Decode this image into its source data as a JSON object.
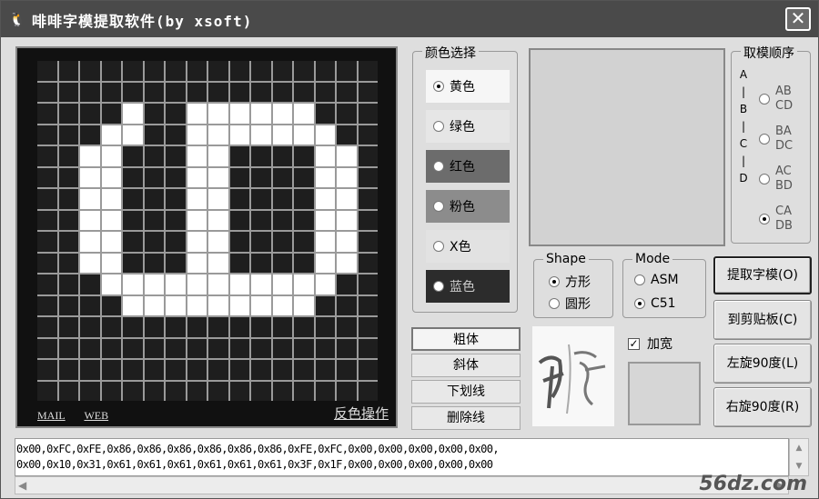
{
  "window": {
    "title": "啡啡字模提取软件(by xsoft)",
    "icon": "penguin-icon",
    "close_label": "✕"
  },
  "grid": {
    "rows": 16,
    "cols": 16,
    "on_cells": [
      [
        2,
        5
      ],
      [
        3,
        5
      ],
      [
        2,
        12
      ],
      [
        2,
        13
      ],
      [
        2,
        14
      ],
      [
        2,
        15
      ],
      [
        2,
        16
      ],
      [
        2,
        17
      ],
      [
        2,
        18
      ],
      [
        2,
        19
      ],
      [
        2,
        20
      ],
      [
        2,
        21
      ],
      [
        2,
        22
      ],
      [
        2,
        23
      ],
      [
        3,
        8
      ],
      [
        3,
        9
      ],
      [
        3,
        10
      ],
      [
        3,
        11
      ],
      [
        3,
        12
      ],
      [
        3,
        13
      ],
      [
        3,
        14
      ],
      [
        3,
        15
      ]
    ],
    "pattern": [
      "0000000000000000",
      "0000000000000000",
      "0000100111111000",
      "0001100111111100",
      "0011000110000110",
      "0011000110000110",
      "0011000110000110",
      "0011000110000110",
      "0011000110000110",
      "0011000110000110",
      "0001111111111100",
      "0000111111111000",
      "0000000000000000",
      "0000000000000000",
      "0000000000000000",
      "0000000000000000"
    ],
    "mail_label": "MAIL",
    "web_label": "WEB",
    "invert_label": "反色操作"
  },
  "color_select": {
    "label": "颜色选择",
    "items": [
      {
        "label": "黄色",
        "bg": "#f6f6f6",
        "fg": "#000",
        "checked": true
      },
      {
        "label": "绿色",
        "bg": "#e6e6e6",
        "fg": "#000",
        "checked": false
      },
      {
        "label": "红色",
        "bg": "#6c6c6c",
        "fg": "#000",
        "checked": false
      },
      {
        "label": "粉色",
        "bg": "#8c8c8c",
        "fg": "#000",
        "checked": false
      },
      {
        "label": "X色",
        "bg": "#e2e2e2",
        "fg": "#000",
        "checked": false
      },
      {
        "label": "蓝色",
        "bg": "#2c2c2c",
        "fg": "#ccc",
        "checked": false
      }
    ]
  },
  "order": {
    "label": "取模顺序",
    "letters": [
      "A",
      "|",
      "B",
      "|",
      "C",
      "|",
      "D"
    ],
    "items": [
      {
        "line1": "AB",
        "line2": "CD",
        "checked": false
      },
      {
        "line1": "BA",
        "line2": "DC",
        "checked": false
      },
      {
        "line1": "AC",
        "line2": "BD",
        "checked": false
      },
      {
        "line1": "CA",
        "line2": "DB",
        "checked": true
      }
    ]
  },
  "shape": {
    "label": "Shape",
    "options": [
      {
        "label": "方形",
        "checked": true
      },
      {
        "label": "圆形",
        "checked": false
      }
    ]
  },
  "mode": {
    "label": "Mode",
    "options": [
      {
        "label": "ASM",
        "checked": false
      },
      {
        "label": "C51",
        "checked": true
      }
    ]
  },
  "style_buttons": [
    "粗体",
    "斜体",
    "下划线",
    "删除线"
  ],
  "widen": {
    "label": "加宽",
    "checked": true
  },
  "actions": [
    "提取字模(O)",
    "到剪贴板(C)",
    "左旋90度(L)",
    "右旋90度(R)"
  ],
  "output": {
    "line1": "0x00,0xFC,0xFE,0x86,0x86,0x86,0x86,0x86,0x86,0xFE,0xFC,0x00,0x00,0x00,0x00,0x00,",
    "line2": "0x00,0x10,0x31,0x61,0x61,0x61,0x61,0x61,0x61,0x3F,0x1F,0x00,0x00,0x00,0x00,0x00"
  },
  "watermark": "56dz.com"
}
